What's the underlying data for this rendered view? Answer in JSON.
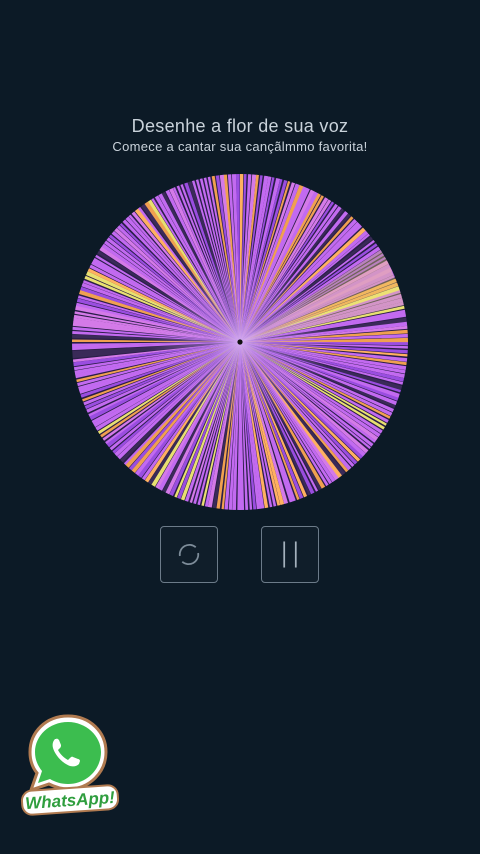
{
  "header": {
    "title": "Desenhe a flor de sua voz",
    "subtitle": "Comece a cantar sua cançãlmmo favorita!"
  },
  "flower": {
    "colors": [
      "#c26af0",
      "#9a4de0",
      "#f0a050",
      "#e8e070",
      "#3a2a58",
      "#d47ae8",
      "#7a44c8",
      "#ffb060"
    ],
    "center_color": "#111111",
    "icon": "voice-flower"
  },
  "controls": {
    "reset": {
      "icon": "refresh-circle-icon"
    },
    "pause": {
      "icon": "pause-icon"
    }
  },
  "watermark": {
    "text": "WhatsApp!",
    "icon": "whatsapp-logo"
  },
  "theme": {
    "background": "#0c1a26",
    "text": "#c9d2da",
    "button_border": "#6c7b89",
    "whatsapp_green": "#3cbd4f"
  }
}
